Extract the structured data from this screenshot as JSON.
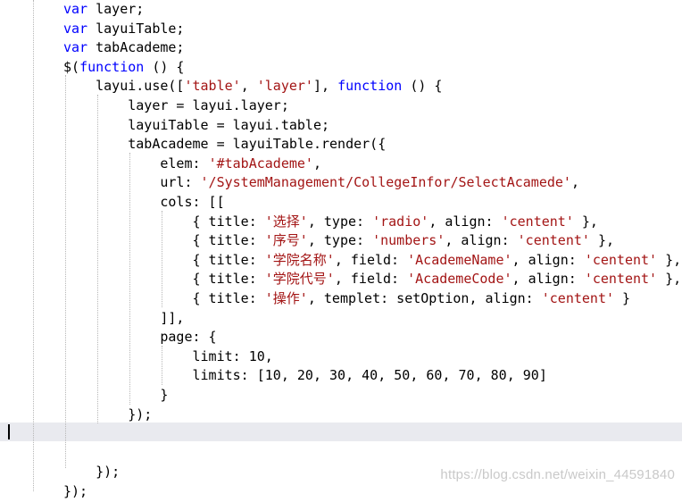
{
  "editor": {
    "lines": [
      [
        {
          "t": "var",
          "c": "kw"
        },
        {
          "t": " layer;",
          "c": "pl"
        }
      ],
      [
        {
          "t": "var",
          "c": "kw"
        },
        {
          "t": " layuiTable;",
          "c": "pl"
        }
      ],
      [
        {
          "t": "var",
          "c": "kw"
        },
        {
          "t": " tabAcademe;",
          "c": "pl"
        }
      ],
      [
        {
          "t": "$(",
          "c": "pl"
        },
        {
          "t": "function",
          "c": "kw"
        },
        {
          "t": " () {",
          "c": "pl"
        }
      ],
      [
        {
          "t": "    layui.use([",
          "c": "pl"
        },
        {
          "t": "'table'",
          "c": "str"
        },
        {
          "t": ", ",
          "c": "pl"
        },
        {
          "t": "'layer'",
          "c": "str"
        },
        {
          "t": "], ",
          "c": "pl"
        },
        {
          "t": "function",
          "c": "kw"
        },
        {
          "t": " () {",
          "c": "pl"
        }
      ],
      [
        {
          "t": "        layer = layui.layer;",
          "c": "pl"
        }
      ],
      [
        {
          "t": "        layuiTable = layui.table;",
          "c": "pl"
        }
      ],
      [
        {
          "t": "        tabAcademe = layuiTable.render({",
          "c": "pl"
        }
      ],
      [
        {
          "t": "            elem: ",
          "c": "pl"
        },
        {
          "t": "'#tabAcademe'",
          "c": "str"
        },
        {
          "t": ",",
          "c": "pl"
        }
      ],
      [
        {
          "t": "            url: ",
          "c": "pl"
        },
        {
          "t": "'/SystemManagement/CollegeInfor/SelectAcamede'",
          "c": "str"
        },
        {
          "t": ",",
          "c": "pl"
        }
      ],
      [
        {
          "t": "            cols: [[",
          "c": "pl"
        }
      ],
      [
        {
          "t": "                { title: ",
          "c": "pl"
        },
        {
          "t": "'选择'",
          "c": "str"
        },
        {
          "t": ", type: ",
          "c": "pl"
        },
        {
          "t": "'radio'",
          "c": "str"
        },
        {
          "t": ", align: ",
          "c": "pl"
        },
        {
          "t": "'centent'",
          "c": "str"
        },
        {
          "t": " },",
          "c": "pl"
        }
      ],
      [
        {
          "t": "                { title: ",
          "c": "pl"
        },
        {
          "t": "'序号'",
          "c": "str"
        },
        {
          "t": ", type: ",
          "c": "pl"
        },
        {
          "t": "'numbers'",
          "c": "str"
        },
        {
          "t": ", align: ",
          "c": "pl"
        },
        {
          "t": "'centent'",
          "c": "str"
        },
        {
          "t": " },",
          "c": "pl"
        }
      ],
      [
        {
          "t": "                { title: ",
          "c": "pl"
        },
        {
          "t": "'学院名称'",
          "c": "str"
        },
        {
          "t": ", field: ",
          "c": "pl"
        },
        {
          "t": "'AcademeName'",
          "c": "str"
        },
        {
          "t": ", align: ",
          "c": "pl"
        },
        {
          "t": "'centent'",
          "c": "str"
        },
        {
          "t": " },",
          "c": "pl"
        }
      ],
      [
        {
          "t": "                { title: ",
          "c": "pl"
        },
        {
          "t": "'学院代号'",
          "c": "str"
        },
        {
          "t": ", field: ",
          "c": "pl"
        },
        {
          "t": "'AcademeCode'",
          "c": "str"
        },
        {
          "t": ", align: ",
          "c": "pl"
        },
        {
          "t": "'centent'",
          "c": "str"
        },
        {
          "t": " },",
          "c": "pl"
        }
      ],
      [
        {
          "t": "                { title: ",
          "c": "pl"
        },
        {
          "t": "'操作'",
          "c": "str"
        },
        {
          "t": ", templet: setOption, align: ",
          "c": "pl"
        },
        {
          "t": "'centent'",
          "c": "str"
        },
        {
          "t": " }",
          "c": "pl"
        }
      ],
      [
        {
          "t": "            ]],",
          "c": "pl"
        }
      ],
      [
        {
          "t": "            page: {",
          "c": "pl"
        }
      ],
      [
        {
          "t": "                limit: 10,",
          "c": "pl"
        }
      ],
      [
        {
          "t": "                limits: [10, 20, 30, 40, 50, 60, 70, 80, 90]",
          "c": "pl"
        }
      ],
      [
        {
          "t": "            }",
          "c": "pl"
        }
      ],
      [
        {
          "t": "        });",
          "c": "pl"
        }
      ],
      [
        {
          "t": "",
          "c": "pl"
        }
      ],
      [
        {
          "t": "",
          "c": "pl"
        }
      ],
      [
        {
          "t": "    });",
          "c": "pl"
        }
      ],
      [
        {
          "t": "});",
          "c": "pl"
        }
      ]
    ],
    "current_line": 23
  },
  "colors": {
    "keyword": "#0000ff",
    "string": "#a31515",
    "plain": "#000000",
    "current_line_bg": "#e9eaef"
  },
  "watermark": "https://blog.csdn.net/weixin_44591840"
}
